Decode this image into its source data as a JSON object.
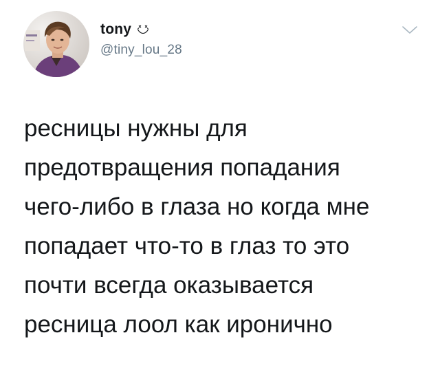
{
  "user": {
    "display_name": "tony",
    "name_emoji_icon": "dizzy-face-emoji-icon",
    "handle": "@tiny_lou_28",
    "avatar": "profile-photo"
  },
  "menu": {
    "icon": "chevron-down-icon"
  },
  "tweet": {
    "lines": [
      "ресницы нужны для",
      "предотвращения попадания",
      "чего-либо в глаза но когда мне",
      "попадает что-то в глаз то это",
      "почти всегда оказывается",
      "ресница лоол как иронично"
    ]
  },
  "colors": {
    "text": "#14171a",
    "secondary_text": "#657786",
    "chevron": "#aab8c2",
    "background": "#ffffff"
  }
}
